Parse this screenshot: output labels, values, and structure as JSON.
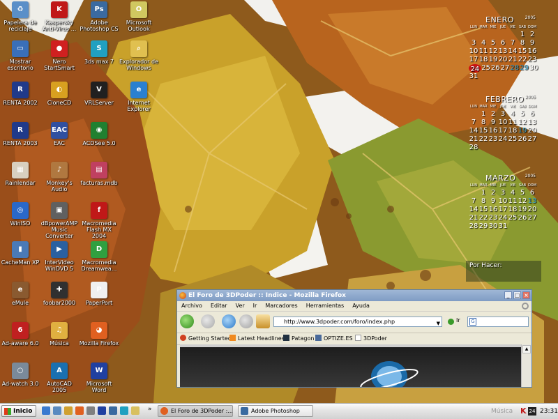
{
  "desktop_icons": [
    {
      "label": "Papelera de reciclaje",
      "icon": "recycle-bin-icon",
      "color": "#5a8fc8",
      "glyph": "♻"
    },
    {
      "label": "Mostrar escritorio",
      "icon": "show-desktop-icon",
      "color": "#3a6fb8",
      "glyph": "▭"
    },
    {
      "label": "RENTA 2002",
      "icon": "renta-icon",
      "color": "#203a8a",
      "glyph": "R"
    },
    {
      "label": "RENTA 2003",
      "icon": "renta-icon",
      "color": "#203a8a",
      "glyph": "R"
    },
    {
      "label": "Rainlendar",
      "icon": "calendar-icon",
      "color": "#d8d0c0",
      "glyph": "▦"
    },
    {
      "label": "WinISO",
      "icon": "winiso-icon",
      "color": "#2a68c8",
      "glyph": "◎"
    },
    {
      "label": "CacheMan XP",
      "icon": "cacheman-icon",
      "color": "#4a7ab8",
      "glyph": "▮"
    },
    {
      "label": "eMule",
      "icon": "emule-icon",
      "color": "#8a5a30",
      "glyph": "e"
    },
    {
      "label": "Ad-aware 6.0",
      "icon": "adaware-icon",
      "color": "#c02020",
      "glyph": "6"
    },
    {
      "label": "Ad-watch 3.0",
      "icon": "adwatch-icon",
      "color": "#7a8a9a",
      "glyph": "○"
    },
    {
      "label": "Kaspersky Anti-Virus ...",
      "icon": "kaspersky-icon",
      "color": "#c01818",
      "glyph": "K"
    },
    {
      "label": "Nero StartSmart",
      "icon": "nero-icon",
      "color": "#d02020",
      "glyph": "●"
    },
    {
      "label": "CloneCD",
      "icon": "clonecd-icon",
      "color": "#d8a020",
      "glyph": "◐"
    },
    {
      "label": "EAC",
      "icon": "eac-icon",
      "color": "#3050a0",
      "glyph": "EAC"
    },
    {
      "label": "Monkey's Audio",
      "icon": "monkeys-audio-icon",
      "color": "#b07840",
      "glyph": "♪"
    },
    {
      "label": "dBpowerAMP Music Converter",
      "icon": "dbpoweramp-icon",
      "color": "#606060",
      "glyph": "▣"
    },
    {
      "label": "InterVideo WinDVD 5",
      "icon": "windvd-icon",
      "color": "#2a60a0",
      "glyph": "▶"
    },
    {
      "label": "foobar2000",
      "icon": "foobar-icon",
      "color": "#303030",
      "glyph": "✚"
    },
    {
      "label": "Música",
      "icon": "music-folder-icon",
      "color": "#e0b040",
      "glyph": "♫"
    },
    {
      "label": "AutoCAD 2005",
      "icon": "autocad-icon",
      "color": "#1a70b0",
      "glyph": "A"
    },
    {
      "label": "Adobe Photoshop CS",
      "icon": "photoshop-icon",
      "color": "#3a6aa0",
      "glyph": "Ps"
    },
    {
      "label": "3ds max 7",
      "icon": "3dsmax-icon",
      "color": "#20a0c0",
      "glyph": "S"
    },
    {
      "label": "VRLServer",
      "icon": "vrlserver-icon",
      "color": "#202020",
      "glyph": "V"
    },
    {
      "label": "ACDSee 5.0",
      "icon": "acdsee-icon",
      "color": "#208030",
      "glyph": "◉"
    },
    {
      "label": "facturas.mdb",
      "icon": "access-db-icon",
      "color": "#c04060",
      "glyph": "▤"
    },
    {
      "label": "Macromedia Flash MX 2004",
      "icon": "flash-icon",
      "color": "#c01818",
      "glyph": "f"
    },
    {
      "label": "Macromedia Dreamwea...",
      "icon": "dreamweaver-icon",
      "color": "#30a040",
      "glyph": "D"
    },
    {
      "label": "PaperPort",
      "icon": "paperport-icon",
      "color": "#f0f0f0",
      "glyph": "P"
    },
    {
      "label": "Mozilla Firefox",
      "icon": "firefox-icon",
      "color": "#e06020",
      "glyph": "◕"
    },
    {
      "label": "Microsoft Word",
      "icon": "word-icon",
      "color": "#2040a0",
      "glyph": "W"
    },
    {
      "label": "Microsoft Outlook",
      "icon": "outlook-icon",
      "color": "#d0c860",
      "glyph": "O"
    },
    {
      "label": "Explorador de Windows",
      "icon": "explorer-icon",
      "color": "#e0c050",
      "glyph": "⌕"
    },
    {
      "label": "Internet Explorer",
      "icon": "internet-explorer-icon",
      "color": "#2a80d0",
      "glyph": "e"
    }
  ],
  "calendar": {
    "year": "2005",
    "weekdays": [
      "LUN",
      "MAR",
      "MIE",
      "JUE",
      "VIE",
      "SAB",
      "DOM"
    ],
    "months": [
      {
        "name": "ENERO",
        "rows": [
          [
            "",
            "",
            "",
            "",
            "",
            "1",
            "2"
          ],
          [
            "3",
            "4",
            "5",
            "6",
            "7",
            "8",
            "9"
          ],
          [
            "10",
            "11",
            "12",
            "13",
            "14",
            "15",
            "16"
          ],
          [
            "17",
            "18",
            "19",
            "20",
            "21",
            "22",
            "23"
          ],
          [
            "24",
            "25",
            "26",
            "27",
            "28",
            "29",
            "30"
          ],
          [
            "31",
            "",
            "",
            "",
            "",
            "",
            ""
          ]
        ],
        "today": "24",
        "highlight": [
          "28",
          "29"
        ]
      },
      {
        "name": "FEBRERO",
        "rows": [
          [
            "",
            "1",
            "2",
            "3",
            "4",
            "5",
            "6"
          ],
          [
            "7",
            "8",
            "9",
            "10",
            "11",
            "12",
            "13"
          ],
          [
            "14",
            "15",
            "16",
            "17",
            "18",
            "19",
            "20"
          ],
          [
            "21",
            "22",
            "23",
            "24",
            "25",
            "26",
            "27"
          ],
          [
            "28",
            "",
            "",
            "",
            "",
            "",
            ""
          ]
        ],
        "highlight": [
          "19"
        ]
      },
      {
        "name": "MARZO",
        "rows": [
          [
            "",
            "1",
            "2",
            "3",
            "4",
            "5",
            "6"
          ],
          [
            "7",
            "8",
            "9",
            "10",
            "11",
            "12",
            "13"
          ],
          [
            "14",
            "15",
            "16",
            "17",
            "18",
            "19",
            "20"
          ],
          [
            "21",
            "22",
            "23",
            "24",
            "25",
            "26",
            "27"
          ],
          [
            "28",
            "29",
            "30",
            "31",
            "",
            "",
            ""
          ]
        ],
        "highlight": [
          "13"
        ]
      }
    ]
  },
  "todo": {
    "label": "Por Hacer:"
  },
  "firefox": {
    "title": "El Foro de 3DPoder :: Indice - Mozilla Firefox",
    "menu": [
      "Archivo",
      "Editar",
      "Ver",
      "Ir",
      "Marcadores",
      "Herramientas",
      "Ayuda"
    ],
    "url": "http://www.3dpoder.com/foro/index.php",
    "go_label": "Ir",
    "search_value": "",
    "bookmarks": [
      "Getting Started",
      "Latest Headlines",
      "Patagon",
      "OPTIZE.ES",
      "3DPoder"
    ]
  },
  "taskbar": {
    "start_label": "Inicio",
    "tasks": [
      "El Foro de 3DPoder :...",
      "Adobe Photoshop"
    ],
    "tray_music": "Música",
    "tray_badge": "24",
    "clock": "23:31"
  }
}
